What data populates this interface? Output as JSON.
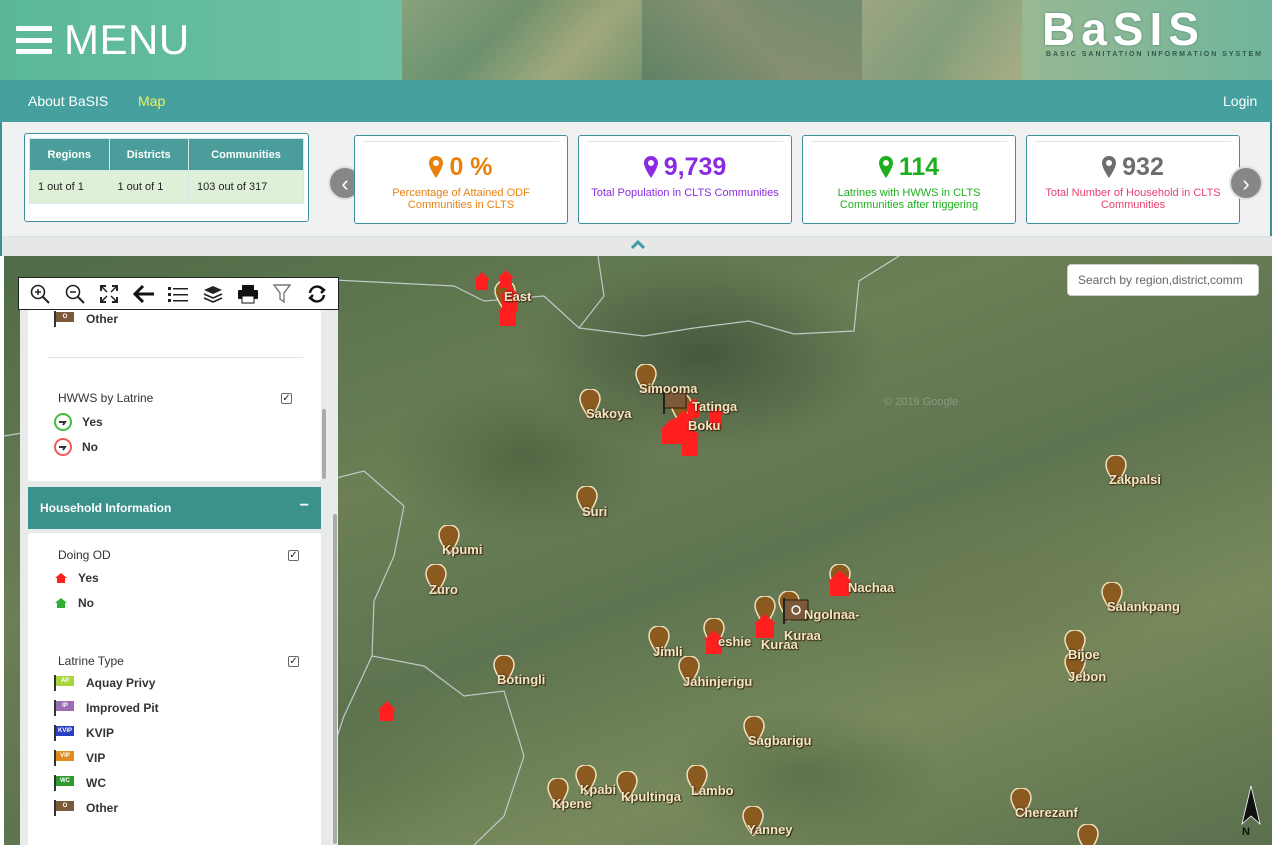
{
  "header": {
    "menu_label": "MENU",
    "logo_text": "BaSIS",
    "logo_subtitle": "BASIC SANITATION INFORMATION SYSTEM"
  },
  "nav": {
    "about": "About BaSIS",
    "map": "Map",
    "login": "Login"
  },
  "summary": {
    "headers": [
      "Regions",
      "Districts",
      "Communities"
    ],
    "values": [
      "1 out of 1",
      "1 out of 1",
      "103 out of 317"
    ]
  },
  "cards": [
    {
      "value": "0 %",
      "desc": "Percentage of Attained ODF Communities in CLTS",
      "color": "#e8810c"
    },
    {
      "value": "9,739",
      "desc": "Total Population in CLTS Communities",
      "color": "#8a2be2"
    },
    {
      "value": "114",
      "desc": "Latrines with HWWS in CLTS Communities after triggering",
      "color": "#1fae1f"
    },
    {
      "value": "932",
      "desc": "Total Number of Household in CLTS Communities",
      "color": "#6d6d6d",
      "desc_color": "#e8416e"
    }
  ],
  "carousel": {
    "prev": "‹",
    "next": "›"
  },
  "map": {
    "search_placeholder": "Search by region,district,comm",
    "watermark": "© 2019 Google",
    "north_label": "N",
    "labels": {
      "east": "East",
      "simooma": "Simooma",
      "tatinga": "Tatinga",
      "sakoya": "Sakoya",
      "boku": "Boku",
      "zakpalsi": "Zakpalsi",
      "suri": "Suri",
      "kpumi": "Kpumi",
      "zuro": "Zuro",
      "nachaa": "Nachaa",
      "salankpang": "Salankpang",
      "ngolnaa": "Ngolnaa-",
      "kuraa2": "Kuraa",
      "kuraa": "Kuraa",
      "eshie": "eshie",
      "jimli": "Jimli",
      "bijoe": "Bijoe",
      "jebon": "Jebon",
      "botingli": "Botingli",
      "jahinjerigu": "Jahinjerigu",
      "sagbarigu": "Sagbarigu",
      "kpabi": "Kpabi",
      "kpene": "Kpene",
      "kpultinga": "Kpultinga",
      "lambo": "Lambo",
      "cherezanf": "Cherezanf",
      "yanney": "Yanney"
    }
  },
  "legend": {
    "other_top": "Other",
    "hwws_title": "HWWS by Latrine",
    "hwws_yes": "Yes",
    "hwws_no": "No",
    "household_title": "Household Information",
    "collapse": "−",
    "doing_od_title": "Doing OD",
    "od_yes": "Yes",
    "od_no": "No",
    "latrine_title": "Latrine Type",
    "latrine_types": [
      {
        "label": "Aquay Privy",
        "code": "AP",
        "color": "#a9d63c"
      },
      {
        "label": "Improved Pit",
        "code": "IP",
        "color": "#9b6bb3"
      },
      {
        "label": "KVIP",
        "code": "KVIP",
        "color": "#2a3fbf"
      },
      {
        "label": "VIP",
        "code": "VIP",
        "color": "#e0891c"
      },
      {
        "label": "WC",
        "code": "WC",
        "color": "#2e9a2e"
      },
      {
        "label": "Other",
        "code": "O",
        "color": "#7b5a3a"
      }
    ]
  }
}
